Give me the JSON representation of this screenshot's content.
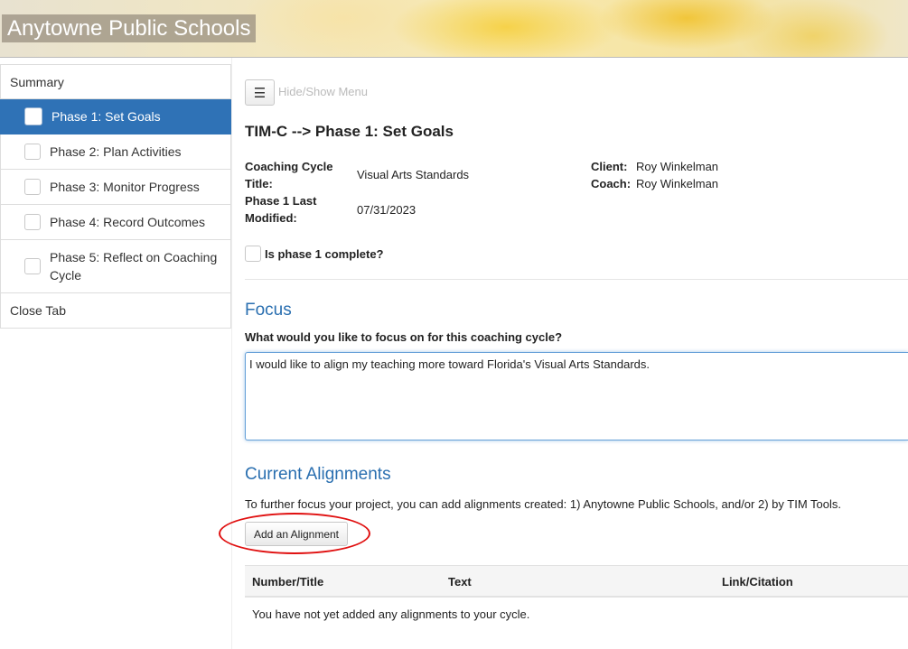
{
  "header": {
    "title": "Anytowne Public Schools"
  },
  "sidebar": {
    "items": [
      {
        "label": "Summary"
      },
      {
        "label": "Phase 1: Set Goals"
      },
      {
        "label": "Phase 2: Plan Activities"
      },
      {
        "label": "Phase 3: Monitor Progress"
      },
      {
        "label": "Phase 4: Record Outcomes"
      },
      {
        "label": "Phase 5: Reflect on Coaching Cycle"
      },
      {
        "label": "Close Tab"
      }
    ],
    "active_item": "Phase 1: Set Goals"
  },
  "toolbar": {
    "menu_icon": "☰",
    "menu_hint": "Hide/Show Menu"
  },
  "page": {
    "title": "TIM-C --> Phase 1: Set Goals"
  },
  "meta": {
    "cycle_title_label": "Coaching Cycle Title:",
    "cycle_title_value": "Visual Arts Standards",
    "modified_label": "Phase 1 Last Modified:",
    "modified_value": "07/31/2023",
    "client_label": "Client:",
    "client_value": "Roy Winkelman",
    "coach_label": "Coach:",
    "coach_value": "Roy Winkelman"
  },
  "phase_complete": {
    "label": "Is phase 1 complete?",
    "checked": false
  },
  "focus": {
    "heading": "Focus",
    "question": "What would you like to focus on for this coaching cycle?",
    "answer": "I would like to align my teaching more toward Florida's Visual Arts Standards."
  },
  "alignments": {
    "heading": "Current Alignments",
    "description": "To further focus your project, you can add alignments created: 1) Anytowne Public Schools, and/or 2) by TIM Tools.",
    "add_button": "Add an Alignment",
    "columns": [
      "Number/Title",
      "Text",
      "Link/Citation"
    ],
    "empty_message": "You have not yet added any alignments to your cycle."
  },
  "colors": {
    "accent": "#2f72b6",
    "heading_blue": "#2a6fb0",
    "highlight_oval": "#e01010"
  }
}
